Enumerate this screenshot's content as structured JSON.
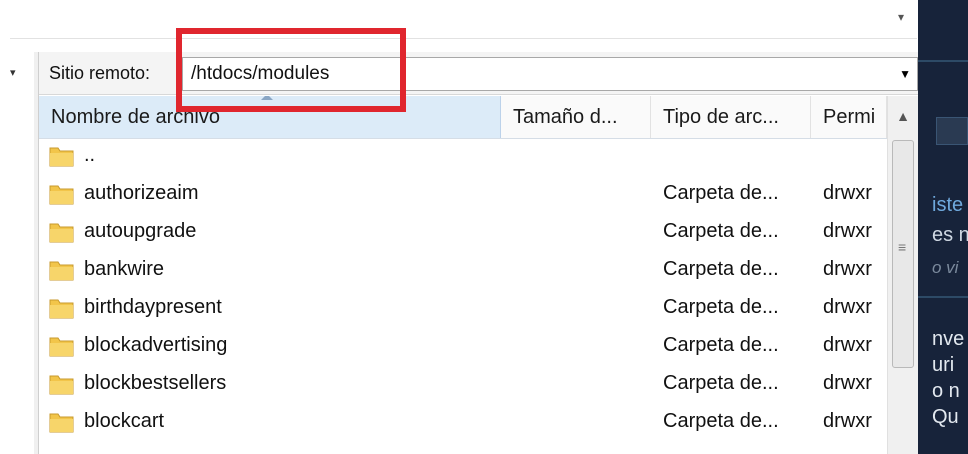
{
  "remote": {
    "label": "Sitio remoto:",
    "path": "/htdocs/modules"
  },
  "columns": [
    "Nombre de archivo",
    "Tamaño d...",
    "Tipo de arc...",
    "Permi"
  ],
  "files": [
    {
      "name": "..",
      "type": "",
      "perm": ""
    },
    {
      "name": "authorizeaim",
      "type": "Carpeta de...",
      "perm": "drwxr"
    },
    {
      "name": "autoupgrade",
      "type": "Carpeta de...",
      "perm": "drwxr"
    },
    {
      "name": "bankwire",
      "type": "Carpeta de...",
      "perm": "drwxr"
    },
    {
      "name": "birthdaypresent",
      "type": "Carpeta de...",
      "perm": "drwxr"
    },
    {
      "name": "blockadvertising",
      "type": "Carpeta de...",
      "perm": "drwxr"
    },
    {
      "name": "blockbestsellers",
      "type": "Carpeta de...",
      "perm": "drwxr"
    },
    {
      "name": "blockcart",
      "type": "Carpeta de...",
      "perm": "drwxr"
    }
  ],
  "background_window": {
    "fragments": [
      "iste",
      "es n",
      "o vi",
      "nve",
      "uri",
      "o n",
      "Qu"
    ]
  },
  "colors": {
    "highlight": "#e0262e",
    "folder": "#f2c54a",
    "sorted_header": "#dcebf8",
    "dark_bg": "#17233a"
  },
  "icons": {
    "folder": "folder-icon",
    "dropdown": "chevron-down-icon",
    "scroll_up": "scroll-up-icon",
    "sort": "sort-ascending-icon"
  }
}
